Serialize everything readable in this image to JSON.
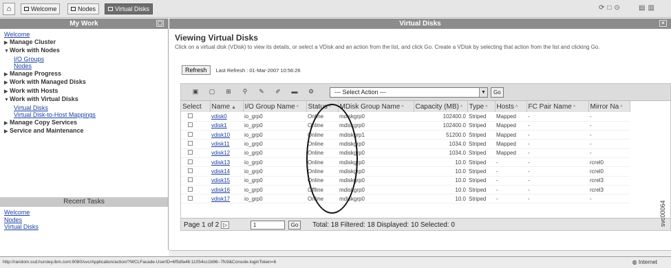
{
  "tabs": [
    {
      "label": "Welcome",
      "active": false
    },
    {
      "label": "Nodes",
      "active": false
    },
    {
      "label": "Virtual Disks",
      "active": true
    }
  ],
  "sidebar": {
    "title": "My Work",
    "nav": [
      {
        "label": "Welcome",
        "type": "link"
      },
      {
        "label": "Manage Cluster",
        "type": "group",
        "expanded": false
      },
      {
        "label": "Work with Nodes",
        "type": "group",
        "expanded": true
      },
      {
        "label": "I/O Groups",
        "type": "sublink"
      },
      {
        "label": "Nodes",
        "type": "sublink"
      },
      {
        "label": "Manage Progress",
        "type": "group",
        "expanded": false
      },
      {
        "label": "Work with Managed Disks",
        "type": "group",
        "expanded": false
      },
      {
        "label": "Work with Hosts",
        "type": "group",
        "expanded": false
      },
      {
        "label": "Work with Virtual Disks",
        "type": "group",
        "expanded": true
      },
      {
        "label": "Virtual Disks",
        "type": "sublink"
      },
      {
        "label": "Virtual Disk-to-Host Mappings",
        "type": "sublink"
      },
      {
        "label": "Manage Copy Services",
        "type": "group",
        "expanded": false
      },
      {
        "label": "Service and Maintenance",
        "type": "group",
        "expanded": false
      }
    ],
    "recent_title": "Recent Tasks",
    "recent": [
      "Welcome",
      "Nodes",
      "Virtual Disks"
    ]
  },
  "main": {
    "panel_title": "Virtual Disks",
    "title": "Viewing Virtual Disks",
    "description": "Click on a virtual disk (VDisk) to view its details, or select a VDisk and an action from the list, and click Go. Create a VDisk by selecting that action from the list and clicking Go.",
    "refresh_label": "Refresh",
    "last_refresh": "Last Refresh : 01-Mar-2007 10:56:26",
    "select_action": "--- Select Action ---",
    "go_label": "Go",
    "columns": [
      "Select",
      "Name",
      "I/O Group Name",
      "Status",
      "MDisk Group Name",
      "Capacity (MB)",
      "Type",
      "Hosts",
      "FC Pair Name",
      "Mirror Na"
    ],
    "rows": [
      [
        "vdisk0",
        "io_grp0",
        "Online",
        "mdiskgrp0",
        "102400.0",
        "Striped",
        "Mapped",
        "-",
        "-"
      ],
      [
        "vdisk1",
        "io_grp0",
        "Online",
        "mdiskgrp0",
        "102400.0",
        "Striped",
        "Mapped",
        "-",
        "-"
      ],
      [
        "vdisk10",
        "io_grp0",
        "Online",
        "mdiskgrp1",
        "51200.0",
        "Striped",
        "Mapped",
        "-",
        "-"
      ],
      [
        "vdisk11",
        "io_grp0",
        "Online",
        "mdiskgrp0",
        "1034.0",
        "Striped",
        "Mapped",
        "-",
        "-"
      ],
      [
        "vdisk12",
        "io_grp0",
        "Online",
        "mdiskgrp0",
        "1034.0",
        "Striped",
        "Mapped",
        "-",
        "-"
      ],
      [
        "vdisk13",
        "io_grp0",
        "Online",
        "mdiskgrp0",
        "10.0",
        "Striped",
        "-",
        "-",
        "rcrel0"
      ],
      [
        "vdisk14",
        "io_grp0",
        "Online",
        "mdiskgrp0",
        "10.0",
        "Striped",
        "-",
        "-",
        "rcrel0"
      ],
      [
        "vdisk15",
        "io_grp0",
        "Online",
        "mdiskgrp0",
        "10.0",
        "Striped",
        "-",
        "-",
        "rcrel3"
      ],
      [
        "vdisk16",
        "io_grp0",
        "Offline",
        "mdiskgrp0",
        "10.0",
        "Striped",
        "-",
        "-",
        "rcrel3"
      ],
      [
        "vdisk17",
        "io_grp0",
        "Online",
        "mdiskgrp0",
        "10.0",
        "Striped",
        "-",
        "-",
        "-"
      ]
    ],
    "pager": {
      "page_label": "Page 1 of 2",
      "page_value": "1",
      "go_label": "Go",
      "summary": "Total: 18   Filtered: 18   Displayed: 10   Selected: 0"
    }
  },
  "statusbar": {
    "url": "http://random.ssd.hursley.ibm.com:9080/svc/Application/action/?WCLFacade.UserID=6f5dfa46:11054cc1b96:-7fc9&Console.loginToken=6",
    "zone": "Internet"
  },
  "figure_id": "svc00064"
}
